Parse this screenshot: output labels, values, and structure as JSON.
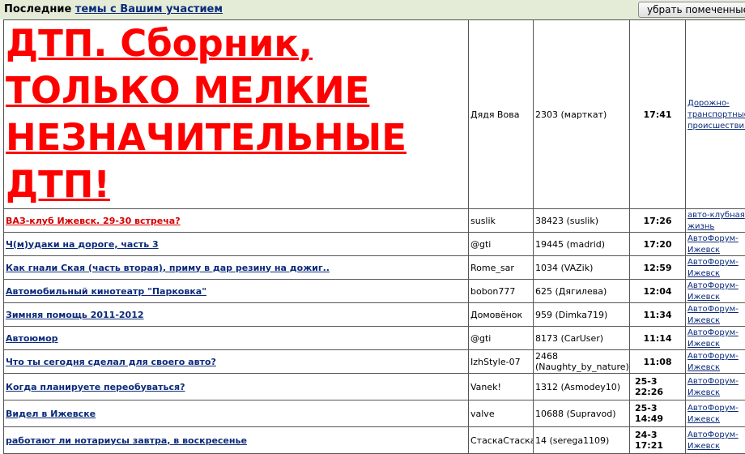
{
  "header": {
    "label": "Последние",
    "link": "темы с Вашим участием",
    "button": "убрать помеченные т"
  },
  "featured": {
    "title": "ДТП. Сборник, ТОЛЬКО МЕЛКИЕ НЕЗНАЧИТЕЛЬНЫЕ ДТП!",
    "author": "Дядя Вова",
    "replies": "2303 (марткат)",
    "time": "17:41",
    "forum": "Дорожно-транспортные происшествия"
  },
  "topics": [
    {
      "title": "ВАЗ-клуб Ижевск. 29-30 встреча?",
      "author": "suslik",
      "replies": "38423 (suslik)",
      "time": "17:26",
      "forum": "авто-клубная жизнь"
    },
    {
      "title": "Ч(м)удаки на дороге, часть 3",
      "author": "@gti",
      "replies": "19445 (madrid)",
      "time": "17:20",
      "forum": "АвтоФорум-Ижевск"
    },
    {
      "title": "Как гнали Ская (часть вторая), приму в дар резину на дожиг..",
      "author": "Rome_sar",
      "replies": "1034 (VAZik)",
      "time": "12:59",
      "forum": "АвтоФорум-Ижевск"
    },
    {
      "title": "Автомобильный кинотеатр \"Парковка\"",
      "author": "bobon777",
      "replies": "625 (Дягилева)",
      "time": "12:04",
      "forum": "АвтоФорум-Ижевск"
    },
    {
      "title": "Зимняя помощь 2011-2012",
      "author": "Домовёнок",
      "replies": "959 (Dimka719)",
      "time": "11:34",
      "forum": "АвтоФорум-Ижевск"
    },
    {
      "title": "Автоюмор",
      "author": "@gti",
      "replies": "8173 (CarUser)",
      "time": "11:14",
      "forum": "АвтоФорум-Ижевск"
    },
    {
      "title": "Что ты сегодня сделал для своего авто?",
      "author": "IzhStyle-07",
      "replies": "2468 (Naughty_by_nature)",
      "time": "11:08",
      "forum": "АвтоФорум-Ижевск"
    },
    {
      "title": "Когда планируете переобуваться?",
      "author": "Vanek!",
      "replies": "1312 (Asmodey10)",
      "time": "25-3 22:26",
      "forum": "АвтоФорум-Ижевск"
    },
    {
      "title": "Видел в Ижевске",
      "author": "valve",
      "replies": "10688 (Supravod)",
      "time": "25-3 14:49",
      "forum": "АвтоФорум-Ижевск"
    },
    {
      "title": "работают ли нотариусы завтра, в воскресенье",
      "author": "СтаскаСтаска",
      "replies": "14 (serega1109)",
      "time": "24-3 17:21",
      "forum": "АвтоФорум-Ижевск"
    }
  ]
}
